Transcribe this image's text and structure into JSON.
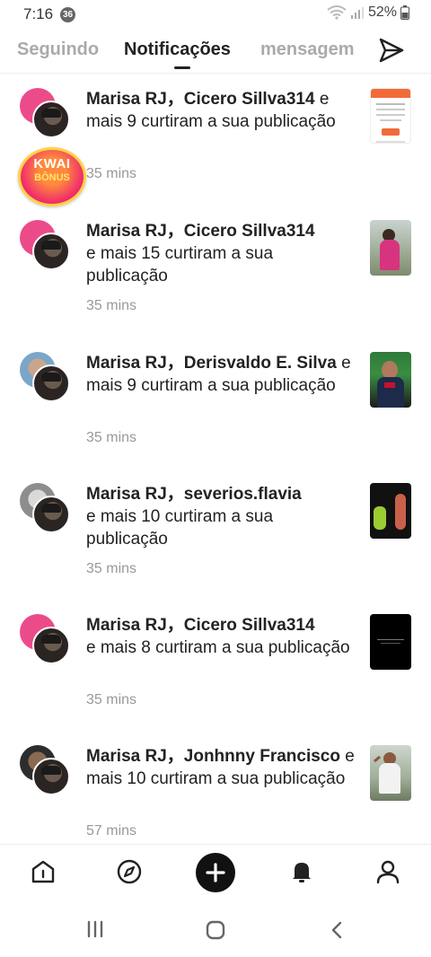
{
  "status": {
    "time": "7:16",
    "badge": "36",
    "battery": "52%"
  },
  "tabs": [
    {
      "label": "Seguindo",
      "active": false
    },
    {
      "label": "Notificações",
      "active": true
    },
    {
      "label": "mensagem",
      "active": false
    }
  ],
  "kwai_badge": {
    "line1": "KWAI",
    "line2": "BÔNUS"
  },
  "notifications": [
    {
      "bold": "Marisa RJ，Cicero Sillva314",
      "rest": "e mais 9 curtiram a sua publicação",
      "time": "35 mins"
    },
    {
      "bold": "Marisa RJ，Cicero Sillva314",
      "rest": "e mais 15 curtiram a sua publicação",
      "time": "35 mins"
    },
    {
      "bold": "Marisa RJ，Derisvaldo E. Silva",
      "rest": "e mais 9 curtiram a sua publicação",
      "time": "35 mins"
    },
    {
      "bold": "Marisa RJ，severios.flavia",
      "rest": "e mais 10 curtiram a sua publicação",
      "time": "35 mins"
    },
    {
      "bold": "Marisa RJ，Cicero Sillva314",
      "rest": "e mais 8 curtiram a sua publicação",
      "time": "35 mins"
    },
    {
      "bold": "Marisa RJ，Jonhnny Francisco",
      "rest": "e mais 10 curtiram a sua publicação",
      "time": "57 mins"
    }
  ],
  "icons": {
    "send": "send-icon",
    "bottom_nav": [
      "home-icon",
      "discover-icon",
      "plus-icon",
      "bell-icon",
      "profile-icon"
    ],
    "system_nav": [
      "recents-icon",
      "home-circle-icon",
      "back-icon"
    ]
  },
  "colors": {
    "accent_pink": "#ec4b8a",
    "kwai_orange": "#ff8a3c",
    "text": "#222222",
    "muted": "#999999"
  }
}
